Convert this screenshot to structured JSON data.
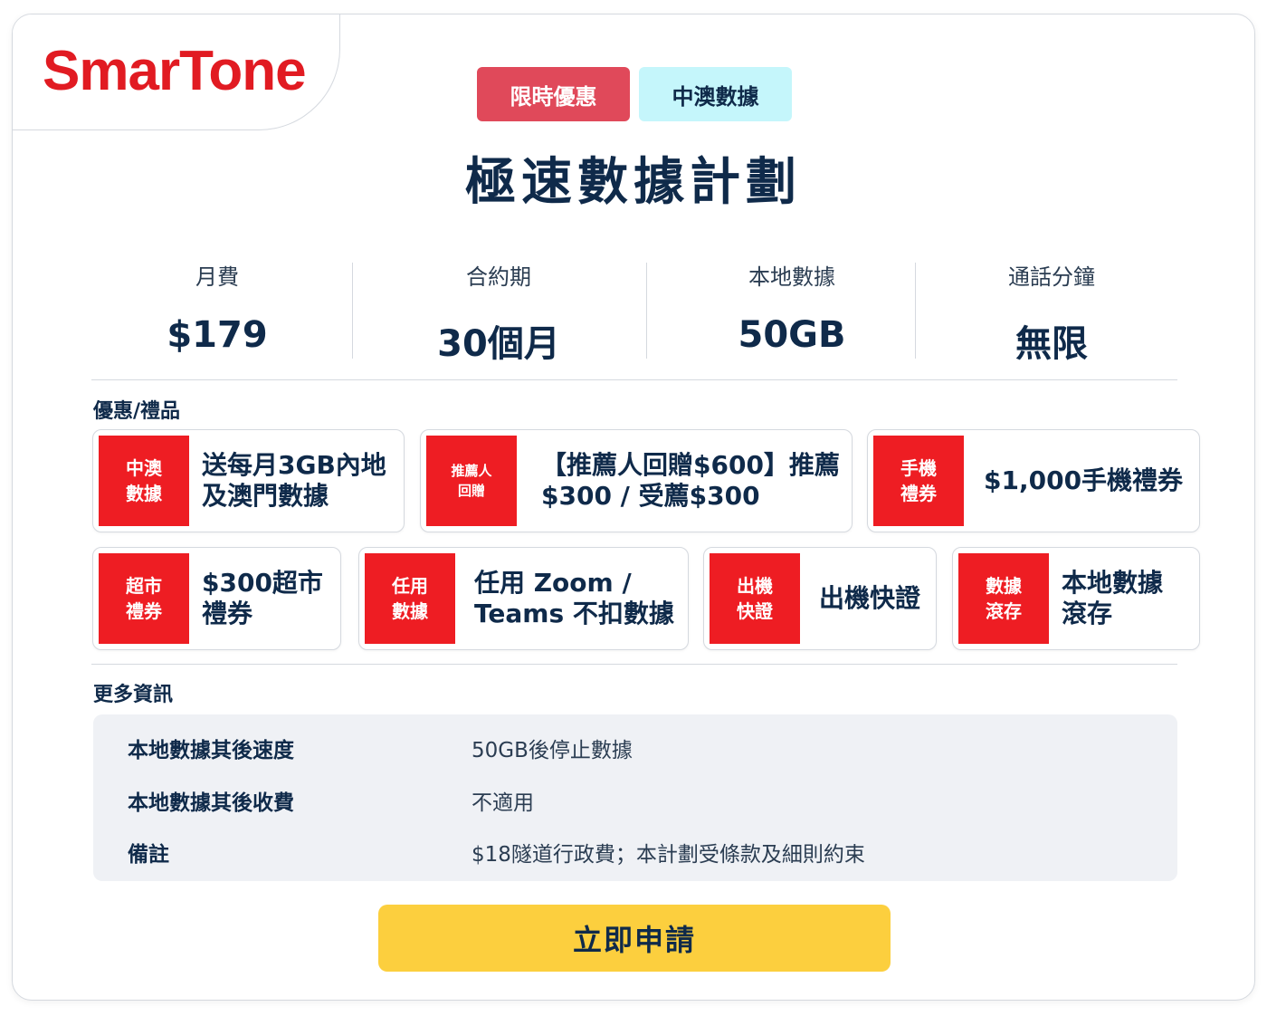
{
  "brand": {
    "logo_text": "SmarTone",
    "color": "#e11b22"
  },
  "tags": [
    {
      "label": "限時優惠",
      "color": "#e0495a"
    },
    {
      "label": "中澳數據",
      "color": "#c5f6fb"
    }
  ],
  "plan": {
    "title": "極速數據計劃"
  },
  "specs": [
    {
      "label": "月費",
      "value": "$179"
    },
    {
      "label": "合約期",
      "value": "30個月"
    },
    {
      "label": "本地數據",
      "value": "50GB"
    },
    {
      "label": "通話分鐘",
      "value": "無限"
    }
  ],
  "offers_section": {
    "label": "優惠/禮品"
  },
  "offers": [
    {
      "icon_text": "中澳\n數據",
      "text": "送每月3GB內地\n及澳門數據"
    },
    {
      "icon_text": "推薦人\n回贈",
      "text": "【推薦人回贈$600】推薦\n$300 / 受薦$300"
    },
    {
      "icon_text": "手機\n禮券",
      "text": "$1,000手機禮券"
    },
    {
      "icon_text": "超市\n禮券",
      "text": "$300超市\n禮券"
    },
    {
      "icon_text": "任用\n數據",
      "text": "任用 Zoom /\nTeams 不扣數據"
    },
    {
      "icon_text": "出機\n快證",
      "text": "出機快證"
    },
    {
      "icon_text": "數據\n滾存",
      "text": "本地數據\n滾存"
    }
  ],
  "info_section": {
    "label": "更多資訊"
  },
  "info": [
    {
      "key": "本地數據其後速度",
      "value": "50GB後停止數據"
    },
    {
      "key": "本地數據其後收費",
      "value": "不適用"
    },
    {
      "key": "備註",
      "value": "$18隧道行政費；本計劃受條款及細則約束"
    }
  ],
  "cta": {
    "label": "立即申請",
    "color": "#fccf3e"
  }
}
